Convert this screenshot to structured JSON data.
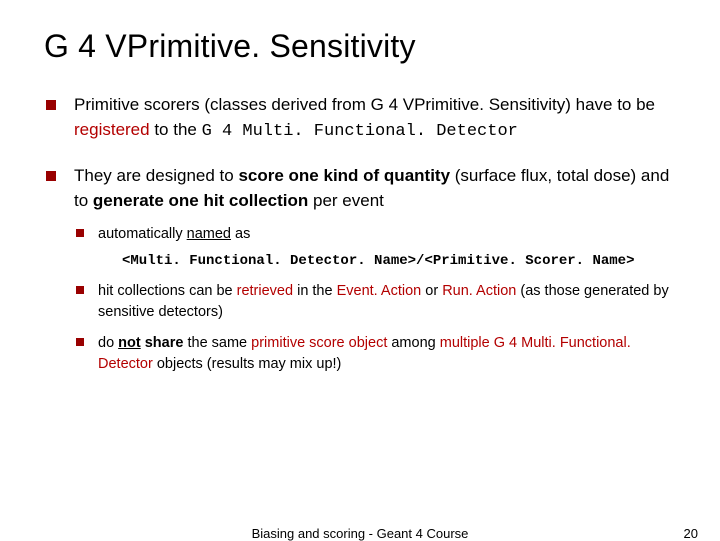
{
  "title": "G 4 VPrimitive. Sensitivity",
  "bullet1": {
    "pre": "Primitive scorers (classes derived from G 4 VPrimitive. Sensitivity) have to be ",
    "reg": "registered",
    "post": " to the ",
    "code": "G 4 Multi. Functional. Detector"
  },
  "bullet2": {
    "a": "They are designed to ",
    "b": "score one kind of quantity",
    "c": " (surface flux, total dose) and to ",
    "d": "generate one hit collection",
    "e": " per event"
  },
  "sub1": {
    "a": "automatically ",
    "b": "named",
    "c": " as"
  },
  "sub1_code": "<Multi. Functional. Detector. Name>/<Primitive. Scorer. Name>",
  "sub2": {
    "a": "hit collections can be ",
    "b": "retrieved",
    "c": " in the ",
    "d": "Event. Action",
    "e": " or ",
    "f": "Run. Action",
    "g": " (as those generated by sensitive detectors)"
  },
  "sub3": {
    "a": "do ",
    "b": "not",
    "c": " share",
    "d": " the same ",
    "e": "primitive score object",
    "f": " among ",
    "g": "multiple G 4 Multi. Functional. Detector",
    "h": " objects (results may mix up!)"
  },
  "footer": {
    "center": "Biasing and scoring - Geant 4 Course",
    "page": "20"
  }
}
